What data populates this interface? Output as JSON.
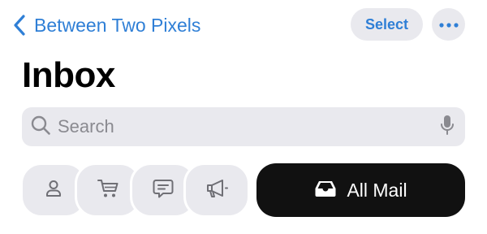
{
  "header": {
    "back_label": "Between Two Pixels",
    "select_label": "Select"
  },
  "page": {
    "title": "Inbox"
  },
  "search": {
    "placeholder": "Search",
    "value": ""
  },
  "categories": [
    {
      "icon": "person-icon"
    },
    {
      "icon": "cart-icon"
    },
    {
      "icon": "chat-bubble-icon"
    },
    {
      "icon": "megaphone-icon"
    }
  ],
  "all_mail": {
    "label": "All Mail",
    "icon": "inbox-tray-icon",
    "selected": true
  },
  "colors": {
    "accent": "#2f7fd6",
    "pill_bg": "#e9e9ee",
    "selected_bg": "#111111",
    "placeholder": "#8a8a90",
    "icon_gray": "#6f6f75"
  }
}
